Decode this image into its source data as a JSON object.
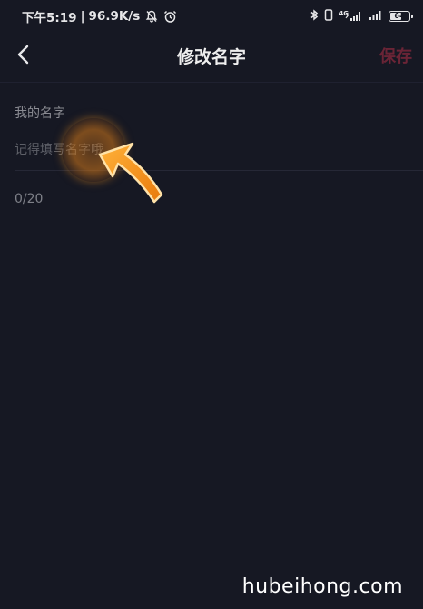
{
  "status_bar": {
    "time": "下午5:19",
    "network_speed": "96.9K/s",
    "network_tag": "4G",
    "battery_level": "64",
    "battery_fraction": 0.64
  },
  "header": {
    "title": "修改名字",
    "save_label": "保存"
  },
  "form": {
    "field_label": "我的名字",
    "input_value": "",
    "input_placeholder": "记得填写名字哦",
    "char_count": "0/20"
  },
  "watermark": "hubeihong.com",
  "icons": {
    "back": "chevron-left-icon",
    "mute": "bell-off-icon",
    "alarm": "alarm-clock-icon",
    "vibrate": "vibrate-icon",
    "battery": "battery-icon"
  },
  "colors": {
    "background": "#161823",
    "save_disabled": "#6b2436",
    "annotation_orange": "#f29a1c"
  }
}
